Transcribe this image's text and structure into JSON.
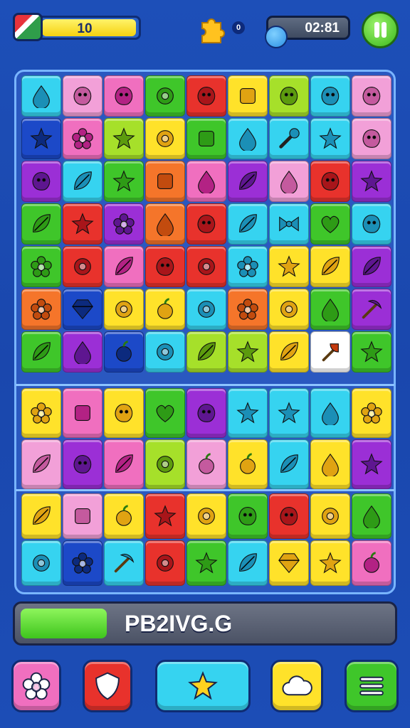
{
  "hud": {
    "score": "10",
    "pieces_count": "0",
    "timer": "02:81",
    "icons": [
      "flag-icon",
      "puzzle-piece-icon",
      "pause-icon"
    ]
  },
  "progress": {
    "label": "PB2IVG.G",
    "fraction": 0.23
  },
  "colors": {
    "green": "#3fc62a",
    "red": "#e8322c",
    "magenta": "#f06fbf",
    "yellow": "#ffe22a",
    "orange": "#f5752a",
    "cyan": "#36d3f0",
    "purple": "#9b2fd6",
    "blue": "#1c49c8",
    "pink": "#f2a0d8",
    "lime": "#a6e02a",
    "white": "#ffffff"
  },
  "board": {
    "top_rows": [
      [
        [
          "cyan",
          "drop"
        ],
        [
          "pink",
          "blob"
        ],
        [
          "magenta",
          "blob"
        ],
        [
          "green",
          "circle"
        ],
        [
          "red",
          "blob"
        ],
        [
          "yellow",
          "square"
        ],
        [
          "lime",
          "blob"
        ],
        [
          "cyan",
          "blob"
        ],
        [
          "pink",
          "blob"
        ]
      ],
      [
        [
          "blue",
          "star"
        ],
        [
          "magenta",
          "flower"
        ],
        [
          "lime",
          "star"
        ],
        [
          "yellow",
          "circle"
        ],
        [
          "green",
          "square"
        ],
        [
          "cyan",
          "drop"
        ],
        [
          "cyan",
          "wand"
        ],
        [
          "cyan",
          "star"
        ],
        [
          "pink",
          "blob"
        ]
      ],
      [
        [
          "purple",
          "blob"
        ],
        [
          "cyan",
          "leaf"
        ],
        [
          "green",
          "star"
        ],
        [
          "orange",
          "square"
        ],
        [
          "magenta",
          "drop"
        ],
        [
          "purple",
          "leaf"
        ],
        [
          "pink",
          "drop"
        ],
        [
          "red",
          "blob"
        ],
        [
          "purple",
          "star"
        ]
      ],
      [
        [
          "green",
          "leaf"
        ],
        [
          "red",
          "star"
        ],
        [
          "purple",
          "flower"
        ],
        [
          "orange",
          "drop"
        ],
        [
          "red",
          "blob"
        ],
        [
          "cyan",
          "leaf"
        ],
        [
          "cyan",
          "bow"
        ],
        [
          "green",
          "heart"
        ],
        [
          "cyan",
          "blob"
        ]
      ],
      [
        [
          "green",
          "flower"
        ],
        [
          "red",
          "circle"
        ],
        [
          "magenta",
          "leaf"
        ],
        [
          "red",
          "blob"
        ],
        [
          "red",
          "circle"
        ],
        [
          "cyan",
          "flower"
        ],
        [
          "yellow",
          "star"
        ],
        [
          "yellow",
          "leaf"
        ],
        [
          "purple",
          "leaf"
        ]
      ],
      [
        [
          "orange",
          "flower"
        ],
        [
          "blue",
          "gem"
        ],
        [
          "yellow",
          "circle"
        ],
        [
          "yellow",
          "fruit"
        ],
        [
          "cyan",
          "circle"
        ],
        [
          "orange",
          "flower"
        ],
        [
          "yellow",
          "circle"
        ],
        [
          "green",
          "drop"
        ],
        [
          "purple",
          "pick"
        ]
      ],
      [
        [
          "green",
          "leaf"
        ],
        [
          "purple",
          "drop"
        ],
        [
          "blue",
          "fruit"
        ],
        [
          "cyan",
          "circle"
        ],
        [
          "lime",
          "leaf"
        ],
        [
          "lime",
          "star"
        ],
        [
          "yellow",
          "leaf"
        ],
        [
          "white",
          "axe"
        ],
        [
          "green",
          "star"
        ]
      ]
    ],
    "mid_rows": [
      [
        [
          "yellow",
          "flower"
        ],
        [
          "magenta",
          "square"
        ],
        [
          "yellow",
          "blob"
        ],
        [
          "green",
          "heart"
        ],
        [
          "purple",
          "blob"
        ],
        [
          "cyan",
          "star"
        ],
        [
          "cyan",
          "star"
        ],
        [
          "cyan",
          "drop"
        ],
        [
          "yellow",
          "flower"
        ]
      ],
      [
        [
          "pink",
          "leaf"
        ],
        [
          "purple",
          "blob"
        ],
        [
          "magenta",
          "leaf"
        ],
        [
          "lime",
          "circle"
        ],
        [
          "pink",
          "fruit"
        ],
        [
          "yellow",
          "fruit"
        ],
        [
          "cyan",
          "leaf"
        ],
        [
          "yellow",
          "drop"
        ],
        [
          "purple",
          "star"
        ]
      ]
    ],
    "bot_rows": [
      [
        [
          "yellow",
          "leaf"
        ],
        [
          "pink",
          "square"
        ],
        [
          "yellow",
          "fruit"
        ],
        [
          "red",
          "star"
        ],
        [
          "yellow",
          "circle"
        ],
        [
          "green",
          "blob"
        ],
        [
          "red",
          "blob"
        ],
        [
          "yellow",
          "circle"
        ],
        [
          "green",
          "drop"
        ]
      ],
      [
        [
          "cyan",
          "circle"
        ],
        [
          "blue",
          "flower"
        ],
        [
          "cyan",
          "pick"
        ],
        [
          "red",
          "circle"
        ],
        [
          "green",
          "star"
        ],
        [
          "cyan",
          "leaf"
        ],
        [
          "yellow",
          "gem"
        ],
        [
          "yellow",
          "star"
        ],
        [
          "magenta",
          "fruit"
        ]
      ]
    ]
  },
  "buttons": [
    {
      "name": "flower-button",
      "color": "magenta",
      "icon": "flower"
    },
    {
      "name": "shield-button",
      "color": "red",
      "icon": "shield"
    },
    {
      "name": "star-button",
      "color": "cyan",
      "icon": "star"
    },
    {
      "name": "cloud-button",
      "color": "yellow",
      "icon": "cloud"
    },
    {
      "name": "menu-button",
      "color": "green",
      "icon": "menu"
    }
  ]
}
